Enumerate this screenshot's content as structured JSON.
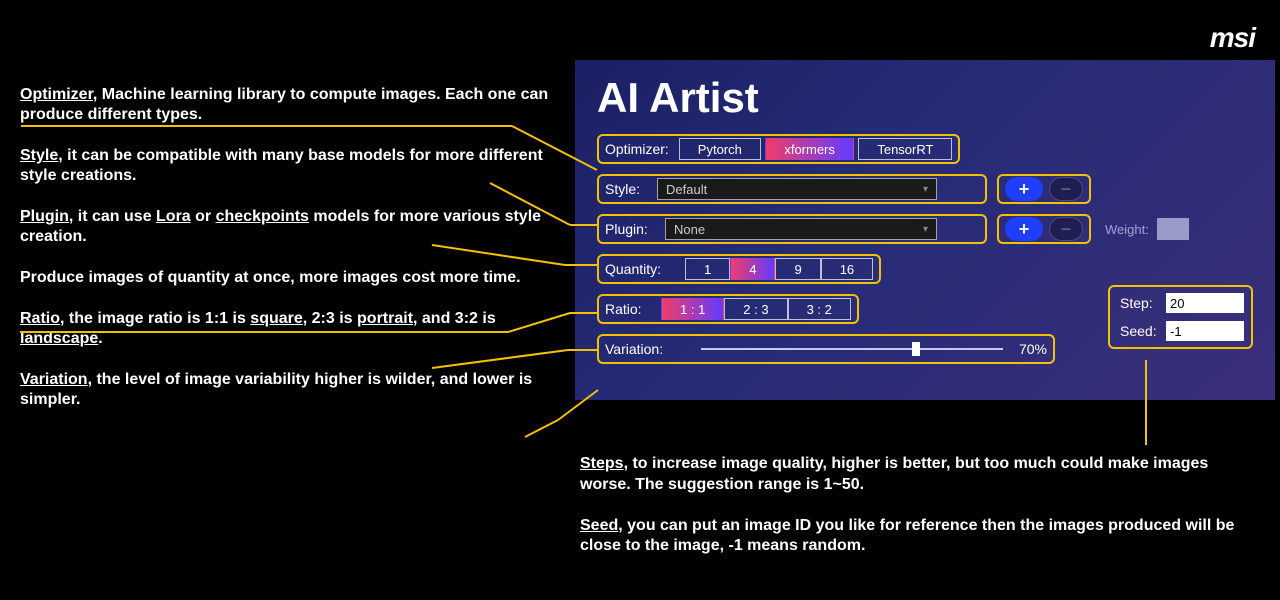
{
  "brand": "msi",
  "panel": {
    "title": "AI Artist",
    "optimizer": {
      "label": "Optimizer:",
      "options": [
        "Pytorch",
        "xformers",
        "TensorRT"
      ],
      "selected": "xformers"
    },
    "style": {
      "label": "Style:",
      "value": "Default"
    },
    "plugin": {
      "label": "Plugin:",
      "value": "None",
      "weight_label": "Weight:"
    },
    "quantity": {
      "label": "Quantity:",
      "options": [
        "1",
        "4",
        "9",
        "16"
      ],
      "selected": "4"
    },
    "ratio": {
      "label": "Ratio:",
      "options": [
        "1 : 1",
        "2 : 3",
        "3 : 2"
      ],
      "selected": "1 : 1"
    },
    "variation": {
      "label": "Variation:",
      "value": "70%"
    },
    "step": {
      "label": "Step:",
      "value": "20"
    },
    "seed": {
      "label": "Seed:",
      "value": "-1"
    }
  },
  "explanations": {
    "optimizer": "Optimizer, Machine learning library to compute images. Each one can produce different types.",
    "style": "Style, it can be compatible with many base models for more different style creations.",
    "plugin": "Plugin, it can use Lora or checkpoints models for more various style creation.",
    "quantity": "Produce images of quantity at once, more images cost more time.",
    "ratio": "Ratio, the image ratio is 1:1 is square, 2:3 is portrait, and 3:2 is landscape.",
    "variation": "Variation, the level of image variability higher is wilder, and lower is simpler.",
    "steps": "Steps, to increase image quality, higher is better, but too much could make images worse. The suggestion range is 1~50.",
    "seed": "Seed, you can put an image ID you like for reference then the images produced will be close to the image, -1 means random."
  }
}
